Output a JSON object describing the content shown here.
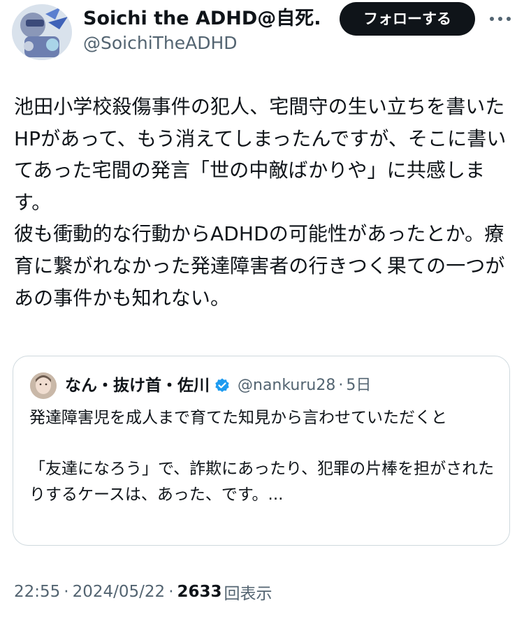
{
  "author": {
    "display_name": "Soichi the ADHD@自死...",
    "handle": "@SoichiTheADHD",
    "avatar_icon": "robot-character-avatar"
  },
  "follow_button": {
    "label": "フォローする"
  },
  "more_icon": "more-horizontal-icon",
  "tweet": {
    "text": "池田小学校殺傷事件の犯人、宅間守の生い立ちを書いたHPがあって、もう消えてしまったんですが、そこに書いてあった宅間の発言「世の中敵ばかりや」に共感します。\n彼も衝動的な行動からADHDの可能性があったとか。療育に繋がれなかった発達障害者の行きつく果ての一つがあの事件かも知れない。"
  },
  "quote": {
    "avatar_icon": "user-avatar",
    "name": "なん・抜け首・佐川",
    "verified_icon": "verified-badge-icon",
    "handle": "@nankuru28",
    "separator": "·",
    "time": "5日",
    "text": "発達障害児を成人まで育てた知見から言わせていただくと\n\n「友達になろう」で、詐欺にあったり、犯罪の片棒を担がされたりするケースは、あった、です。..."
  },
  "meta": {
    "time": "22:55",
    "separator": "·",
    "date": "2024/05/22",
    "views_count": "2633",
    "views_label": "回表示"
  },
  "colors": {
    "text_primary": "#0f1419",
    "text_secondary": "#536471",
    "border": "#cfd9de",
    "verified": "#1d9bf0",
    "button_bg": "#0f1419",
    "button_text": "#ffffff"
  }
}
